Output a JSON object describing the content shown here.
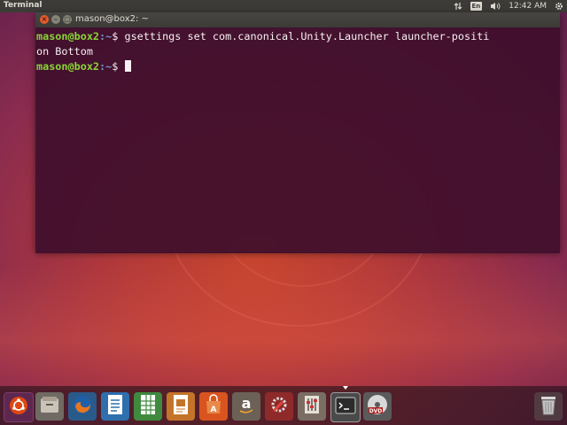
{
  "top_panel": {
    "app_name": "Terminal",
    "keyboard_layout": "En",
    "clock": "12:42 AM",
    "icons": [
      "network-arrows-icon",
      "keyboard-layout-icon",
      "volume-icon",
      "gear-icon"
    ]
  },
  "terminal": {
    "title": "mason@box2: ~",
    "lines": [
      {
        "user": "mason@box2",
        "path": ":~",
        "prompt": "$ ",
        "text": "gsettings set com.canonical.Unity.Launcher launcher-positi"
      },
      {
        "user": "",
        "path": "",
        "prompt": "",
        "text": "on Bottom"
      },
      {
        "user": "mason@box2",
        "path": ":~",
        "prompt": "$ ",
        "text": ""
      }
    ],
    "button_labels": {
      "close": "×",
      "minimize": "–",
      "maximize": "□"
    }
  },
  "launcher": {
    "items": [
      {
        "name": "dash-home",
        "glyph": "◉"
      },
      {
        "name": "files",
        "glyph": "▤"
      },
      {
        "name": "firefox",
        "glyph": "●"
      },
      {
        "name": "libreoffice-writer",
        "glyph": "≡"
      },
      {
        "name": "libreoffice-calc",
        "glyph": "▦"
      },
      {
        "name": "libreoffice-impress",
        "glyph": "▣"
      },
      {
        "name": "software-center",
        "glyph": "A"
      },
      {
        "name": "amazon",
        "glyph": "a"
      },
      {
        "name": "system-settings",
        "glyph": "✱"
      },
      {
        "name": "mixer-settings",
        "glyph": "⫶"
      },
      {
        "name": "terminal",
        "glyph": ">_"
      },
      {
        "name": "dvd",
        "glyph": "DVD"
      },
      {
        "name": "trash",
        "glyph": "🗑"
      }
    ],
    "active": "terminal"
  }
}
